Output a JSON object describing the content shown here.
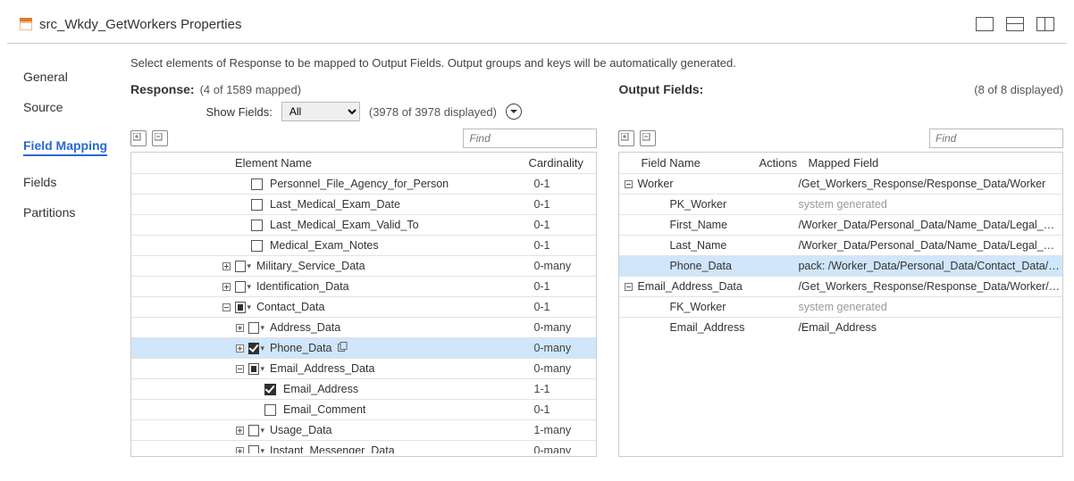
{
  "title": "src_Wkdy_GetWorkers Properties",
  "sidenav": {
    "items": [
      {
        "label": "General"
      },
      {
        "label": "Source"
      },
      {
        "label": "Field Mapping",
        "active": true
      },
      {
        "label": "Fields"
      },
      {
        "label": "Partitions"
      }
    ]
  },
  "instruction": "Select elements of Response to be mapped to Output Fields. Output groups and keys will be automatically generated.",
  "response": {
    "title": "Response:",
    "mapped_text": "(4 of 1589 mapped)",
    "show_fields_label": "Show Fields:",
    "show_fields_value": "All",
    "displayed_text": "(3978 of 3978 displayed)",
    "find_placeholder": "Find",
    "headers": {
      "name": "Element Name",
      "card": "Cardinality"
    },
    "rows": [
      {
        "indent": 3,
        "expand": "",
        "chk": "none",
        "caret": false,
        "name": "Personnel_File_Agency_for_Person",
        "card": "0-1"
      },
      {
        "indent": 3,
        "expand": "",
        "chk": "none",
        "caret": false,
        "name": "Last_Medical_Exam_Date",
        "card": "0-1"
      },
      {
        "indent": 3,
        "expand": "",
        "chk": "none",
        "caret": false,
        "name": "Last_Medical_Exam_Valid_To",
        "card": "0-1"
      },
      {
        "indent": 3,
        "expand": "",
        "chk": "none",
        "caret": false,
        "name": "Medical_Exam_Notes",
        "card": "0-1"
      },
      {
        "indent": 2,
        "expand": "plus",
        "chk": "none",
        "caret": true,
        "name": "Military_Service_Data",
        "card": "0-many"
      },
      {
        "indent": 2,
        "expand": "plus",
        "chk": "none",
        "caret": true,
        "name": "Identification_Data",
        "card": "0-1"
      },
      {
        "indent": 2,
        "expand": "minus",
        "chk": "indet",
        "caret": true,
        "name": "Contact_Data",
        "card": "0-1"
      },
      {
        "indent": 3,
        "expand": "plus",
        "chk": "none",
        "caret": true,
        "name": "Address_Data",
        "card": "0-many"
      },
      {
        "indent": 3,
        "expand": "plus",
        "chk": "checked",
        "caret": true,
        "name": "Phone_Data",
        "card": "0-many",
        "selected": true,
        "copy": true
      },
      {
        "indent": 3,
        "expand": "minus",
        "chk": "indet",
        "caret": true,
        "name": "Email_Address_Data",
        "card": "0-many"
      },
      {
        "indent": 4,
        "expand": "",
        "chk": "checked",
        "caret": false,
        "name": "Email_Address",
        "card": "1-1"
      },
      {
        "indent": 4,
        "expand": "",
        "chk": "none",
        "caret": false,
        "name": "Email_Comment",
        "card": "0-1"
      },
      {
        "indent": 3,
        "expand": "plus",
        "chk": "none",
        "caret": true,
        "name": "Usage_Data",
        "card": "1-many"
      },
      {
        "indent": 3,
        "expand": "plus",
        "chk": "none",
        "caret": true,
        "name": "Instant_Messenger_Data",
        "card": "0-many"
      }
    ]
  },
  "output": {
    "title": "Output Fields:",
    "displayed_text": "(8 of 8 displayed)",
    "find_placeholder": "Find",
    "headers": {
      "name": "Field Name",
      "actions": "Actions",
      "mapped": "Mapped Field"
    },
    "rows": [
      {
        "indent": 0,
        "expand": "minus",
        "name": "Worker",
        "mapped": "/Get_Workers_Response/Response_Data/Worker"
      },
      {
        "indent": 1,
        "expand": "",
        "name": "PK_Worker",
        "mapped": "system generated",
        "gray": true
      },
      {
        "indent": 1,
        "expand": "",
        "name": "First_Name",
        "mapped": "/Worker_Data/Personal_Data/Name_Data/Legal_Name_D"
      },
      {
        "indent": 1,
        "expand": "",
        "name": "Last_Name",
        "mapped": "/Worker_Data/Personal_Data/Name_Data/Legal_Name_D"
      },
      {
        "indent": 1,
        "expand": "",
        "name": "Phone_Data",
        "mapped": "pack: /Worker_Data/Personal_Data/Contact_Data/Phone_",
        "selected": true
      },
      {
        "indent": 0,
        "expand": "minus",
        "name": "Email_Address_Data",
        "mapped": "/Get_Workers_Response/Response_Data/Worker/Worker_"
      },
      {
        "indent": 1,
        "expand": "",
        "name": "FK_Worker",
        "mapped": "system generated",
        "gray": true
      },
      {
        "indent": 1,
        "expand": "",
        "name": "Email_Address",
        "mapped": "/Email_Address"
      }
    ]
  }
}
